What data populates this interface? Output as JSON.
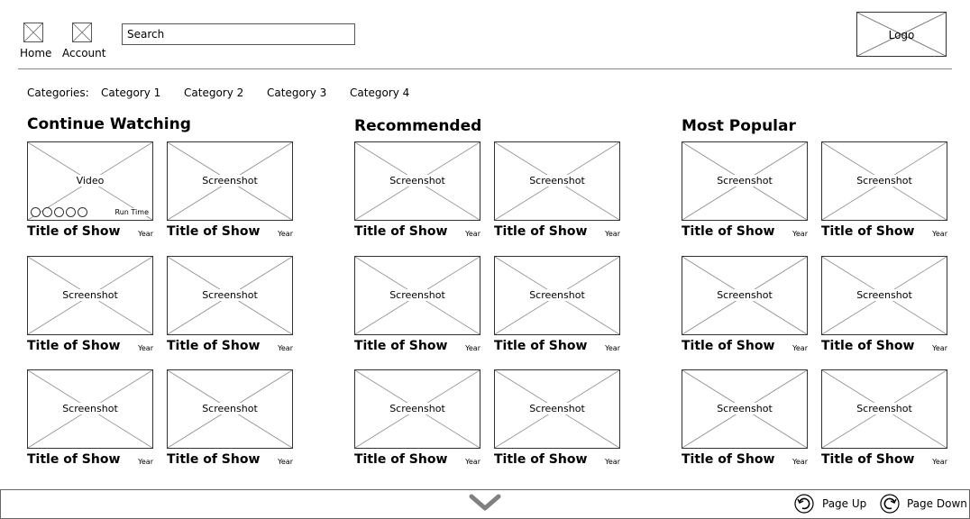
{
  "header": {
    "home_label": "Home",
    "account_label": "Account",
    "search_placeholder": "Search",
    "logo_label": "Logo"
  },
  "categories": {
    "label": "Categories:",
    "items": [
      "Category 1",
      "Category 2",
      "Category 3",
      "Category 4"
    ]
  },
  "sections": [
    {
      "title": "Continue Watching",
      "cards": [
        {
          "thumb": "Video",
          "title": "Title of Show",
          "year": "Year",
          "run_time": "Run Time",
          "is_video": true
        },
        {
          "thumb": "Screenshot",
          "title": "Title of Show",
          "year": "Year"
        },
        {
          "thumb": "Screenshot",
          "title": "Title of Show",
          "year": "Year"
        },
        {
          "thumb": "Screenshot",
          "title": "Title of Show",
          "year": "Year"
        },
        {
          "thumb": "Screenshot",
          "title": "Title of Show",
          "year": "Year"
        },
        {
          "thumb": "Screenshot",
          "title": "Title of Show",
          "year": "Year"
        }
      ]
    },
    {
      "title": "Recommended",
      "cards": [
        {
          "thumb": "Screenshot",
          "title": "Title of Show",
          "year": "Year"
        },
        {
          "thumb": "Screenshot",
          "title": "Title of Show",
          "year": "Year"
        },
        {
          "thumb": "Screenshot",
          "title": "Title of Show",
          "year": "Year"
        },
        {
          "thumb": "Screenshot",
          "title": "Title of Show",
          "year": "Year"
        },
        {
          "thumb": "Screenshot",
          "title": "Title of Show",
          "year": "Year"
        },
        {
          "thumb": "Screenshot",
          "title": "Title of Show",
          "year": "Year"
        }
      ]
    },
    {
      "title": "Most Popular",
      "cards": [
        {
          "thumb": "Screenshot",
          "title": "Title of Show",
          "year": "Year"
        },
        {
          "thumb": "Screenshot",
          "title": "Title of Show",
          "year": "Year"
        },
        {
          "thumb": "Screenshot",
          "title": "Title of Show",
          "year": "Year"
        },
        {
          "thumb": "Screenshot",
          "title": "Title of Show",
          "year": "Year"
        },
        {
          "thumb": "Screenshot",
          "title": "Title of Show",
          "year": "Year"
        },
        {
          "thumb": "Screenshot",
          "title": "Title of Show",
          "year": "Year"
        }
      ]
    }
  ],
  "footer": {
    "page_up_label": "Page Up",
    "page_down_label": "Page Down",
    "scroll_icon": "chevron-down-icon",
    "accent_color": "#808080"
  }
}
